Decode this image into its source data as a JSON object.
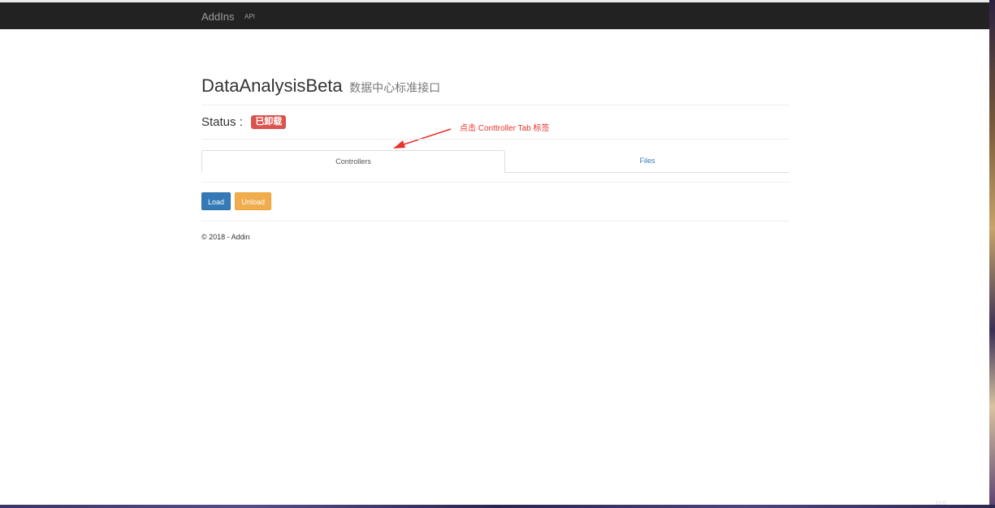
{
  "navbar": {
    "brand": "AddIns",
    "links": [
      {
        "label": "API"
      }
    ]
  },
  "page": {
    "title": "DataAnalysisBeta",
    "subtitle": "数据中心标准接口"
  },
  "status": {
    "label": "Status :",
    "badge": "已卸载",
    "badge_color": "#d9534f"
  },
  "annotation": {
    "text": "点击 Conttroller Tab 标签",
    "color": "#e8332e"
  },
  "tabs": [
    {
      "label": "Controllers",
      "active": true
    },
    {
      "label": "Files",
      "active": false
    }
  ],
  "buttons": {
    "load_label": "Load",
    "unload_label": "Unload",
    "load_color": "#337ab7",
    "unload_color": "#f0ad4e"
  },
  "footer": {
    "text": "© 2018 - Addin"
  },
  "taskbar": {
    "clock": "12:0"
  }
}
